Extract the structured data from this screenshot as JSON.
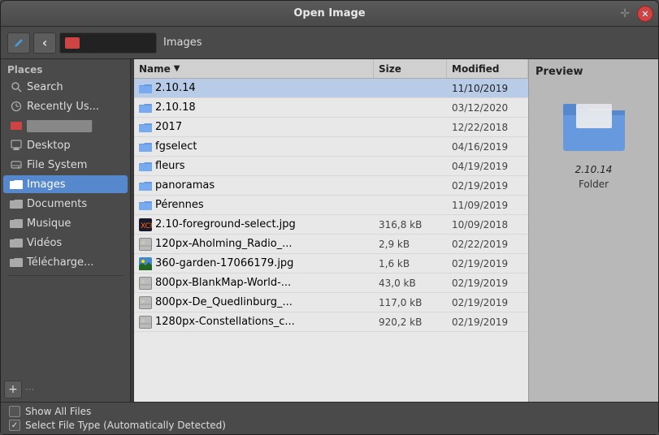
{
  "window": {
    "title": "Open Image"
  },
  "toolbar": {
    "back_btn": "‹",
    "folder_icon_color": "#cc4444",
    "location_path": "",
    "location_label": "Images"
  },
  "sidebar": {
    "section_label": "Places",
    "items": [
      {
        "id": "search",
        "label": "Search",
        "icon": "search"
      },
      {
        "id": "recently-used",
        "label": "Recently Us...",
        "icon": "clock"
      },
      {
        "id": "redacted",
        "label": "",
        "icon": "redacted",
        "is_redacted": true
      },
      {
        "id": "desktop",
        "label": "Desktop",
        "icon": "desktop"
      },
      {
        "id": "file-system",
        "label": "File System",
        "icon": "drive"
      },
      {
        "id": "images",
        "label": "Images",
        "icon": "folder",
        "active": true
      },
      {
        "id": "documents",
        "label": "Documents",
        "icon": "folder"
      },
      {
        "id": "musique",
        "label": "Musique",
        "icon": "folder"
      },
      {
        "id": "videos",
        "label": "Vidéos",
        "icon": "folder"
      },
      {
        "id": "telecharge",
        "label": "Télécharge...",
        "icon": "folder"
      }
    ],
    "add_btn": "+",
    "dots": "···"
  },
  "file_list": {
    "columns": [
      {
        "id": "name",
        "label": "Name"
      },
      {
        "id": "size",
        "label": "Size"
      },
      {
        "id": "modified",
        "label": "Modified"
      }
    ],
    "rows": [
      {
        "name": "2.10.14",
        "size": "",
        "modified": "11/10/2019",
        "type": "folder",
        "selected": true
      },
      {
        "name": "2.10.18",
        "size": "",
        "modified": "03/12/2020",
        "type": "folder"
      },
      {
        "name": "2017",
        "size": "",
        "modified": "12/22/2018",
        "type": "folder"
      },
      {
        "name": "fgselect",
        "size": "",
        "modified": "04/16/2019",
        "type": "folder"
      },
      {
        "name": "fleurs",
        "size": "",
        "modified": "04/19/2019",
        "type": "folder"
      },
      {
        "name": "panoramas",
        "size": "",
        "modified": "02/19/2019",
        "type": "folder"
      },
      {
        "name": "Pérennes",
        "size": "",
        "modified": "11/09/2019",
        "type": "folder"
      },
      {
        "name": "2.10-foreground-select.jpg",
        "size": "316,8 kB",
        "modified": "10/09/2018",
        "type": "image-gimp"
      },
      {
        "name": "120px-Aholming_Radio_...",
        "size": "2,9 kB",
        "modified": "02/22/2019",
        "type": "image"
      },
      {
        "name": "360-garden-17066179.jpg",
        "size": "1,6 kB",
        "modified": "02/19/2019",
        "type": "image-color"
      },
      {
        "name": "800px-BlankMap-World-...",
        "size": "43,0 kB",
        "modified": "02/19/2019",
        "type": "image"
      },
      {
        "name": "800px-De_Quedlinburg_...",
        "size": "117,0 kB",
        "modified": "02/19/2019",
        "type": "image"
      },
      {
        "name": "1280px-Constellations_c...",
        "size": "920,2 kB",
        "modified": "02/19/2019",
        "type": "image"
      }
    ]
  },
  "preview": {
    "title": "Preview",
    "filename": "2.10.14",
    "type": "Folder"
  },
  "bottom": {
    "show_all_files_label": "Show All Files",
    "select_file_type_label": "Select File Type (Automatically Detected)"
  }
}
